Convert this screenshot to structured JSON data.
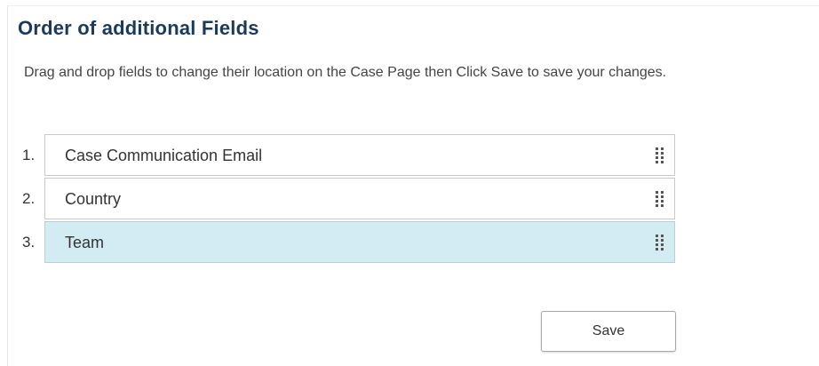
{
  "header": {
    "title": "Order of additional Fields"
  },
  "instructions": "Drag and drop fields to change their location on the Case Page then Click Save to save your changes.",
  "fields": [
    {
      "index": "1.",
      "label": "Case Communication Email",
      "selected": false
    },
    {
      "index": "2.",
      "label": "Country",
      "selected": false
    },
    {
      "index": "3.",
      "label": "Team",
      "selected": true
    }
  ],
  "actions": {
    "save_label": "Save"
  },
  "icons": {
    "drag_handle": "drag-handle-icon"
  },
  "colors": {
    "title": "#1b3a5c",
    "selected_row": "#d3ebf3"
  }
}
